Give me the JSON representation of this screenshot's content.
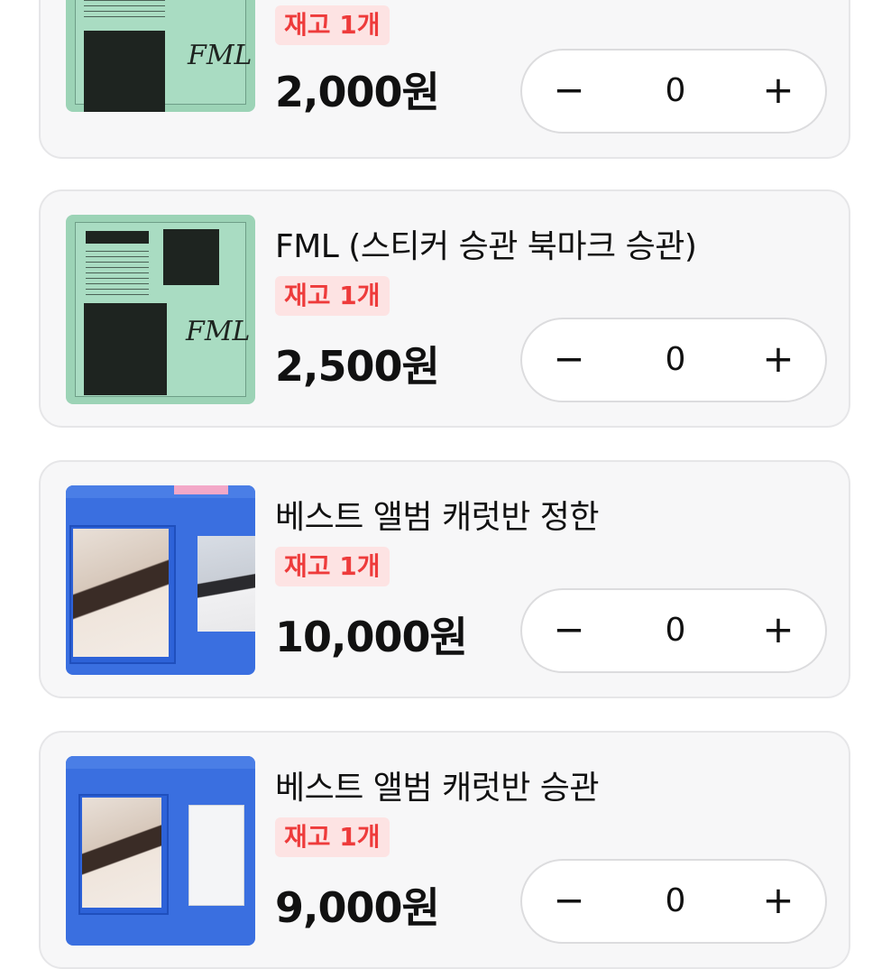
{
  "products": [
    {
      "title": "",
      "stock": "재고 1개",
      "price": "2,000원",
      "quantity": "0",
      "image": "album-fml-green",
      "image_fml": "FML"
    },
    {
      "title": "FML (스티커 승관 북마크 승관)",
      "stock": "재고 1개",
      "price": "2,500원",
      "quantity": "0",
      "image": "album-fml-green",
      "image_fml": "FML"
    },
    {
      "title": "베스트 앨범 캐럿반 정한",
      "stock": "재고 1개",
      "price": "10,000원",
      "quantity": "0",
      "image": "album-best-blue"
    },
    {
      "title": "베스트 앨범 캐럿반 승관",
      "stock": "재고 1개",
      "price": "9,000원",
      "quantity": "0",
      "image": "album-best-blue"
    }
  ],
  "stepper": {
    "minus_icon": "minus-icon",
    "plus_icon": "plus-icon",
    "minus_glyph": "−",
    "plus_glyph": "+"
  },
  "colors": {
    "stock_badge_bg": "#fde3e3",
    "stock_badge_text": "#ee3b3b",
    "card_bg": "#f7f7f8"
  }
}
